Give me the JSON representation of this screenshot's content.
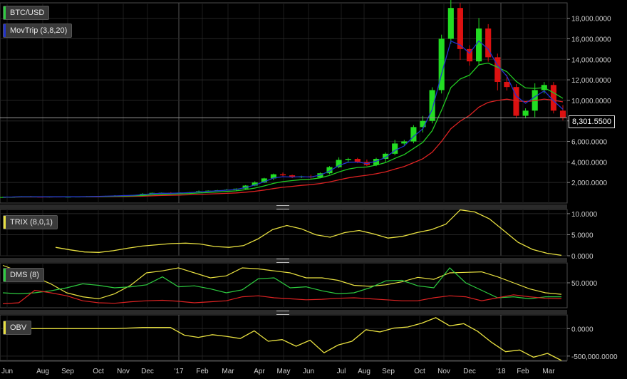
{
  "panels": {
    "main_label": "BTC/USD",
    "main_color": "#2ecc40",
    "ma_label": "MovTrip (3,8,20)",
    "ma_color": "#2233cc",
    "trix_label": "TRIX (8,0,1)",
    "trix_color": "#e8e040",
    "dms_label": "DMS (8)",
    "dms_color": "#2ecc40",
    "obv_label": "OBV",
    "obv_color": "#e8e040"
  },
  "price_tag": "8,301.5500",
  "chart_data": [
    {
      "type": "candlestick",
      "name": "BTC/USD",
      "ylim": [
        0,
        19500
      ],
      "y_ticks": [
        "2,000.0000",
        "4,000.0000",
        "6,000.0000",
        "8,000.0000",
        "10,000.0000",
        "12,000.0000",
        "14,000.0000",
        "16,000.0000",
        "18,000.0000"
      ],
      "y_tick_values": [
        2000,
        4000,
        6000,
        8000,
        10000,
        12000,
        14000,
        16000,
        18000
      ],
      "x_ticks": [
        "Jun",
        "Aug",
        "Sep",
        "Oct",
        "Nov",
        "Dec",
        "'17",
        "Feb",
        "Mar",
        "Apr",
        "May",
        "Jun",
        "Jul",
        "Aug",
        "Sep",
        "Oct",
        "Nov",
        "Dec",
        "'18",
        "Feb",
        "Mar"
      ],
      "current_price": 8301.55,
      "up_color": "#22dd22",
      "down_color": "#dd1111",
      "ma_colors": [
        "#2233cc",
        "#22cc22",
        "#dd2222"
      ],
      "price_path_weekly": [
        580,
        600,
        650,
        610,
        590,
        620,
        600,
        610,
        620,
        640,
        650,
        690,
        720,
        760,
        780,
        900,
        990,
        1000,
        950,
        1010,
        1050,
        1150,
        1200,
        1250,
        1300,
        1400,
        1700,
        2000,
        2400,
        2800,
        2700,
        2500,
        2600,
        2500,
        2900,
        3500,
        4200,
        4300,
        4000,
        3700,
        4300,
        4800,
        5800,
        6000,
        7400,
        8000,
        11000,
        16000,
        19000,
        15000,
        13800,
        17000,
        14200,
        11800,
        11300,
        8500,
        9000,
        11000,
        11500,
        9000,
        8300
      ]
    },
    {
      "type": "line",
      "name": "TRIX (8,0,1)",
      "ylim": [
        0,
        11
      ],
      "y_ticks": [
        "0.0000",
        "5.0000",
        "10.0000"
      ],
      "y_tick_values": [
        0,
        5,
        10
      ],
      "values": [
        2.0,
        1.4,
        0.9,
        0.8,
        1.2,
        1.8,
        2.3,
        2.6,
        2.9,
        3.0,
        2.8,
        2.2,
        2.0,
        2.4,
        4.0,
        6.2,
        7.2,
        6.4,
        5.0,
        4.4,
        5.5,
        6.0,
        5.2,
        4.2,
        4.6,
        5.5,
        6.2,
        7.5,
        10.9,
        10.4,
        8.8,
        6.0,
        3.2,
        1.5,
        0.6,
        0.1
      ]
    },
    {
      "type": "line",
      "name": "DMS (8)",
      "ylim": [
        0,
        90
      ],
      "y_ticks": [
        "50.0000"
      ],
      "y_tick_values": [
        50
      ],
      "series": [
        {
          "values": [
            85,
            73,
            62,
            48,
            30,
            22,
            18,
            28,
            45,
            70,
            74,
            80,
            70,
            60,
            64,
            80,
            78,
            74,
            70,
            60,
            60,
            55,
            45,
            43,
            46,
            52,
            61,
            57,
            70,
            71,
            72,
            62,
            50,
            38,
            30,
            27
          ]
        },
        {
          "values": [
            30,
            28,
            30,
            34,
            40,
            48,
            45,
            40,
            42,
            46,
            62,
            42,
            44,
            38,
            30,
            36,
            58,
            60,
            40,
            42,
            34,
            28,
            30,
            40,
            54,
            55,
            44,
            40,
            80,
            50,
            35,
            20,
            22,
            18,
            22,
            22
          ]
        },
        {
          "values": [
            8,
            10,
            35,
            30,
            24,
            14,
            10,
            9,
            12,
            14,
            15,
            13,
            10,
            12,
            14,
            22,
            24,
            20,
            18,
            16,
            17,
            19,
            20,
            18,
            16,
            14,
            14,
            20,
            24,
            22,
            14,
            20,
            26,
            22,
            19,
            18
          ]
        }
      ]
    },
    {
      "type": "line",
      "name": "OBV",
      "ylim": [
        -580000,
        250000
      ],
      "y_ticks": [
        "0.0000",
        "-500,000.0000"
      ],
      "y_tick_values": [
        0,
        -500000
      ],
      "values": [
        0,
        0,
        0,
        0,
        0,
        0,
        0,
        0,
        0,
        10000,
        20000,
        20000,
        20000,
        -120000,
        -160000,
        -110000,
        -140000,
        -180000,
        -40000,
        -230000,
        -200000,
        -320000,
        -210000,
        -440000,
        -300000,
        -230000,
        -20000,
        -60000,
        10000,
        30000,
        100000,
        200000,
        50000,
        90000,
        -50000,
        -250000,
        -420000,
        -390000,
        -520000,
        -450000,
        -580000
      ]
    }
  ]
}
